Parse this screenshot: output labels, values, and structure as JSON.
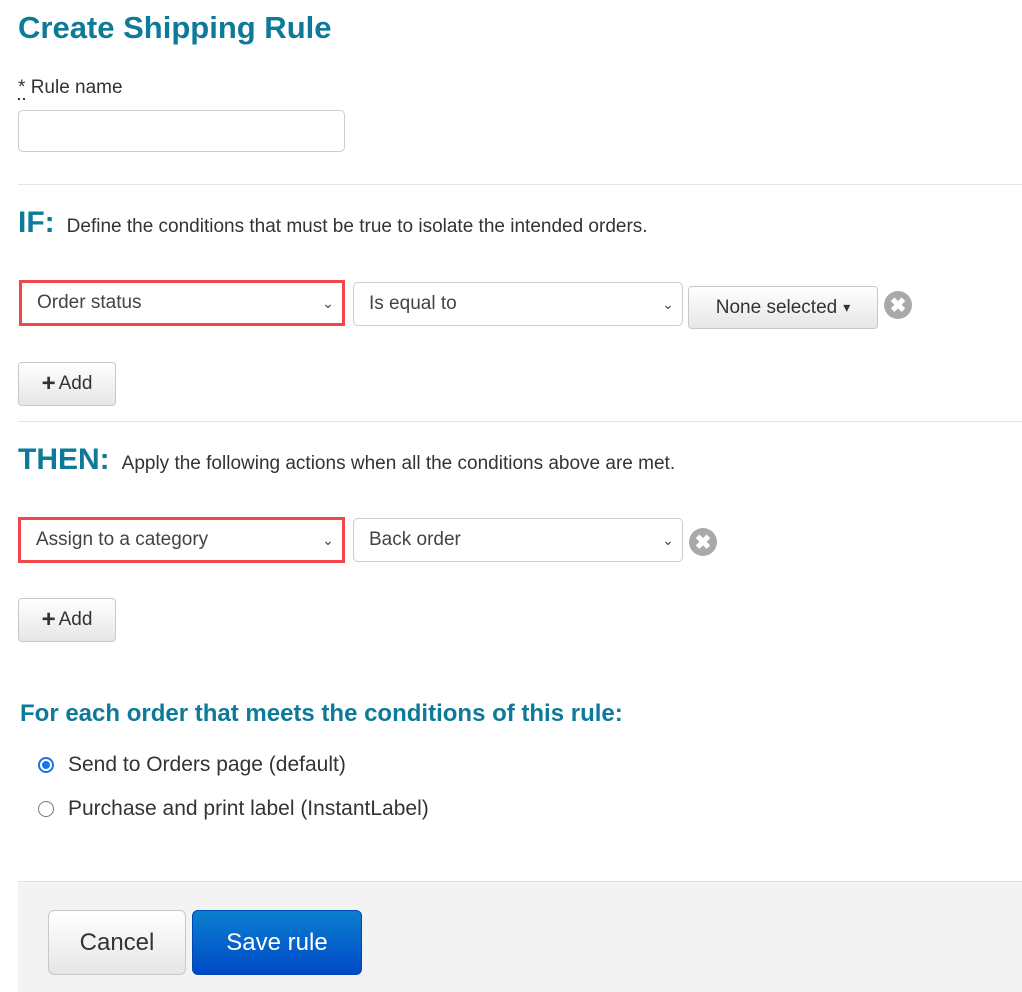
{
  "page": {
    "title": "Create Shipping Rule"
  },
  "rule_name": {
    "required_marker": "*",
    "label": "Rule name",
    "value": "",
    "placeholder": ""
  },
  "if_section": {
    "keyword": "IF:",
    "description": "Define the conditions that must be true to isolate the intended orders.",
    "conditions": [
      {
        "field": "Order status",
        "operator": "Is equal to",
        "value": "None selected"
      }
    ],
    "add_label": "Add"
  },
  "then_section": {
    "keyword": "THEN:",
    "description": "Apply the following actions when all the conditions above are met.",
    "actions": [
      {
        "action": "Assign to a category",
        "value": "Back order"
      }
    ],
    "add_label": "Add"
  },
  "destination": {
    "heading": "For each order that meets the conditions of this rule:",
    "options": [
      {
        "label": "Send to Orders page (default)",
        "selected": true
      },
      {
        "label": "Purchase and print label (InstantLabel)",
        "selected": false
      }
    ]
  },
  "footer": {
    "cancel_label": "Cancel",
    "save_label": "Save rule"
  },
  "colors": {
    "heading": "#0d7a99",
    "highlight": "#f0474b",
    "primary": "#0056c8"
  },
  "icons": {
    "plus": "+",
    "remove": "✖",
    "caret": "▾",
    "chevron": "⌄"
  }
}
